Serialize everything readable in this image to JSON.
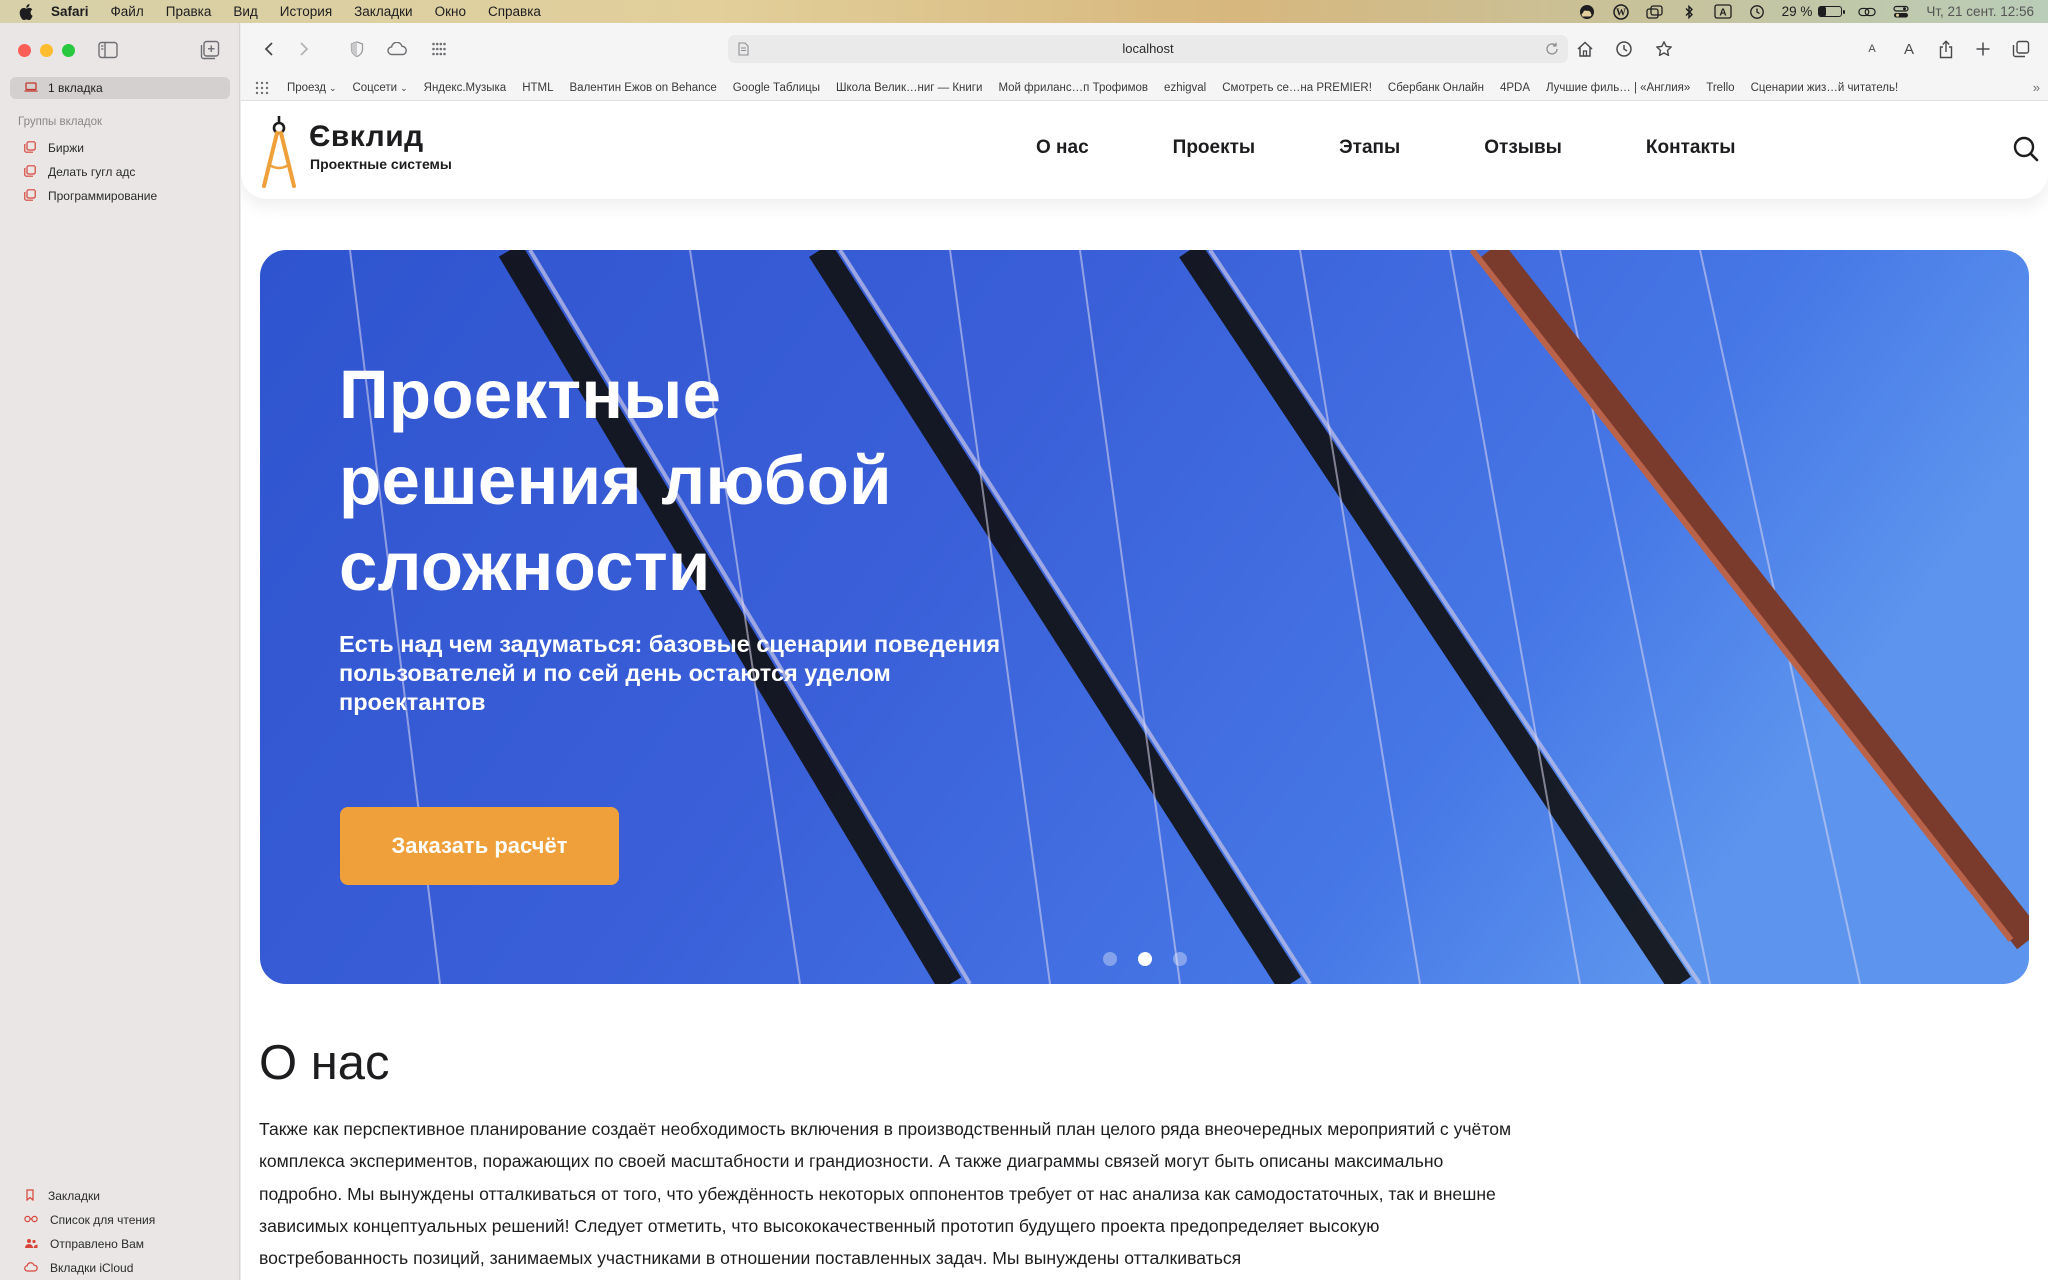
{
  "menubar": {
    "app": "Safari",
    "items": [
      "Файл",
      "Правка",
      "Вид",
      "История",
      "Закладки",
      "Окно",
      "Справка"
    ],
    "battery_percent": "29 %",
    "battery_level": 0.29,
    "keyboard_layout": "A",
    "clock": "Чт, 21 сент.  12:56"
  },
  "sidebar": {
    "current_tab": "1 вкладка",
    "groups_title": "Группы вкладок",
    "groups": [
      "Биржи",
      "Делать гугл адс",
      "Программирование"
    ],
    "bottom": [
      "Закладки",
      "Список для чтения",
      "Отправлено Вам",
      "Вкладки iCloud"
    ]
  },
  "toolbar": {
    "url": "localhost"
  },
  "favorites": {
    "items": [
      {
        "label": "Проезд",
        "dropdown": true
      },
      {
        "label": "Соцсети",
        "dropdown": true
      },
      {
        "label": "Яндекс.Музыка"
      },
      {
        "label": "HTML"
      },
      {
        "label": "Валентин Ежов on Behance"
      },
      {
        "label": "Google Таблицы"
      },
      {
        "label": "Школа Велик…ниг — Книги"
      },
      {
        "label": "Мой фриланс…п Трофимов"
      },
      {
        "label": "ezhigval"
      },
      {
        "label": "Смотреть се…на PREMIER!"
      },
      {
        "label": "Сбербанк Онлайн"
      },
      {
        "label": "4PDA"
      },
      {
        "label": "Лучшие филь… | «Англия»"
      },
      {
        "label": "Trello"
      },
      {
        "label": "Сценарии жиз…й читатель!"
      }
    ]
  },
  "site": {
    "logo_title": "Євклид",
    "logo_subtitle": "Проектные системы",
    "nav": [
      "О нас",
      "Проекты",
      "Этапы",
      "Отзывы",
      "Контакты"
    ],
    "colors": {
      "accent": "#f0a03a",
      "hero_blue": "#3a5fd6",
      "text": "#1d1d1f"
    }
  },
  "hero": {
    "title_lines": [
      "Проектные",
      "решения любой",
      "сложности"
    ],
    "subtitle": "Есть над чем задуматься: базовые сценарии поведения пользователей и по сей день остаются уделом проектантов",
    "cta": "Заказать расчёт",
    "slides_count": 3,
    "active_slide": 2
  },
  "about": {
    "title": "О нас",
    "text": "Также как перспективное планирование создаёт необходимость включения в производственный план целого ряда внеочередных мероприятий с учётом комплекса экспериментов, поражающих по своей масштабности и грандиозности. А также диаграммы связей могут быть описаны максимально подробно. Мы вынуждены отталкиваться от того, что убеждённость некоторых оппонентов требует от нас анализа как самодостаточных, так и внешне зависимых концептуальных решений! Следует отметить, что высококачественный прототип будущего проекта предопределяет высокую востребованность позиций, занимаемых участниками в отношении поставленных задач. Мы вынуждены отталкиваться"
  }
}
